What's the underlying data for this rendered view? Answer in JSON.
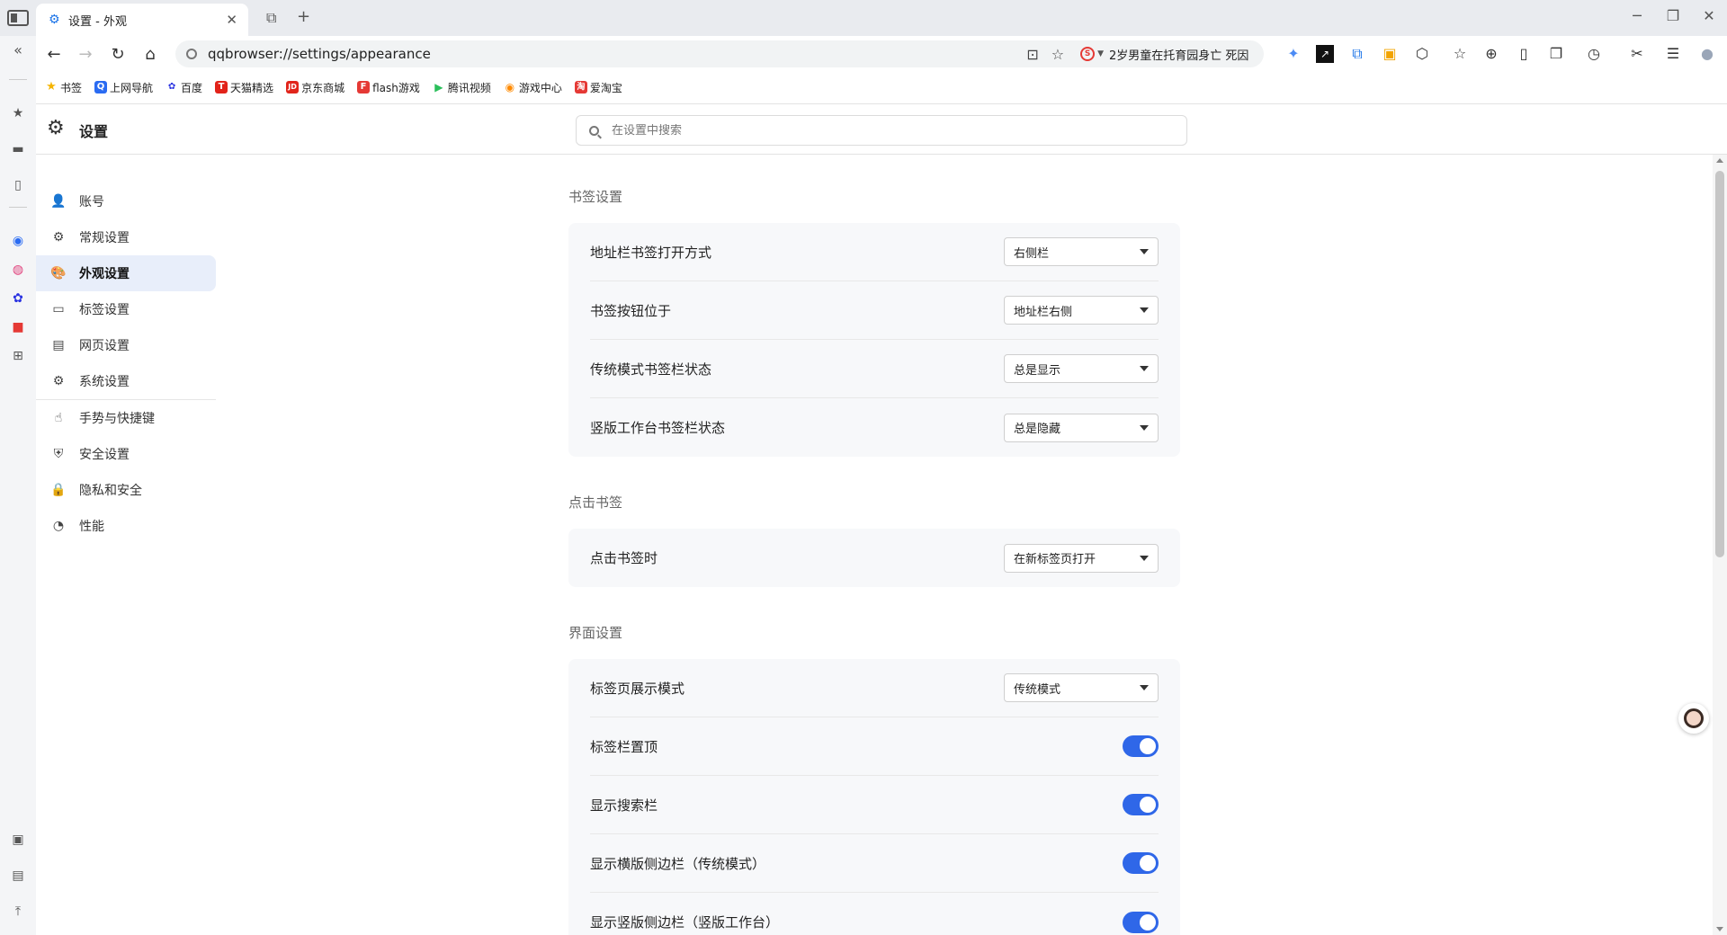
{
  "tab": {
    "title": "设置 - 外观",
    "close": "✕"
  },
  "window_controls": {
    "minimize": "─",
    "restore": "❐",
    "close": "✕"
  },
  "toolbar": {
    "url": "qqbrowser://settings/appearance",
    "news_text": "2岁男童在托育园身亡 死因",
    "news_logo": "S"
  },
  "bookmarks": [
    {
      "label": "书签",
      "icon_color": "#f5b400",
      "glyph": "★"
    },
    {
      "label": "上网导航",
      "icon_color": "#2a6bf2",
      "glyph": "Q"
    },
    {
      "label": "百度",
      "icon_color": "#2932e1",
      "glyph": "✿"
    },
    {
      "label": "天猫精选",
      "icon_color": "#e2231a",
      "glyph": "T"
    },
    {
      "label": "京东商城",
      "icon_color": "#e1251b",
      "glyph": "JD"
    },
    {
      "label": "flash游戏",
      "icon_color": "#e53935",
      "glyph": "F"
    },
    {
      "label": "腾讯视频",
      "icon_color": "#2bbf5b",
      "glyph": "▶"
    },
    {
      "label": "游戏中心",
      "icon_color": "#ff8a00",
      "glyph": "◉"
    },
    {
      "label": "爱淘宝",
      "icon_color": "#e53935",
      "glyph": "淘"
    }
  ],
  "settings": {
    "title": "设置",
    "search_placeholder": "在设置中搜索"
  },
  "nav": {
    "items": [
      {
        "label": "账号",
        "icon": "user-icon",
        "glyph": "👤"
      },
      {
        "label": "常规设置",
        "icon": "gear-icon",
        "glyph": "⚙"
      },
      {
        "label": "外观设置",
        "icon": "palette-icon",
        "glyph": "🎨",
        "active": true
      },
      {
        "label": "标签设置",
        "icon": "tab-icon",
        "glyph": "▭"
      },
      {
        "label": "网页设置",
        "icon": "webpage-settings-icon",
        "glyph": "▤"
      },
      {
        "label": "系统设置",
        "icon": "system-gears-icon",
        "glyph": "⚙"
      },
      {
        "label": "手势与快捷键",
        "icon": "hand-gesture-icon",
        "glyph": "☝"
      },
      {
        "label": "安全设置",
        "icon": "shield-icon",
        "glyph": "⛨"
      },
      {
        "label": "隐私和安全",
        "icon": "lock-icon",
        "glyph": "🔒"
      },
      {
        "label": "性能",
        "icon": "performance-gauge-icon",
        "glyph": "◔"
      }
    ]
  },
  "sections": {
    "bookmark_settings": {
      "title": "书签设置",
      "rows": [
        {
          "label": "地址栏书签打开方式",
          "value": "右侧栏"
        },
        {
          "label": "书签按钮位于",
          "value": "地址栏右侧"
        },
        {
          "label": "传统模式书签栏状态",
          "value": "总是显示"
        },
        {
          "label": "竖版工作台书签栏状态",
          "value": "总是隐藏"
        }
      ]
    },
    "click_bookmark": {
      "title": "点击书签",
      "rows": [
        {
          "label": "点击书签时",
          "value": "在新标签页打开"
        }
      ]
    },
    "interface_settings": {
      "title": "界面设置",
      "rows": [
        {
          "label": "标签页展示模式",
          "value": "传统模式"
        },
        {
          "label": "标签栏置顶",
          "toggle": true
        },
        {
          "label": "显示搜索栏",
          "toggle": true
        },
        {
          "label": "显示横版侧边栏（传统模式）",
          "toggle": true
        },
        {
          "label": "显示竖版侧边栏（竖版工作台）",
          "toggle": true
        }
      ]
    }
  },
  "colors": {
    "accent": "#2f67e8",
    "active_nav_bg": "#e8eefa",
    "card_bg": "#f7f8fa"
  }
}
